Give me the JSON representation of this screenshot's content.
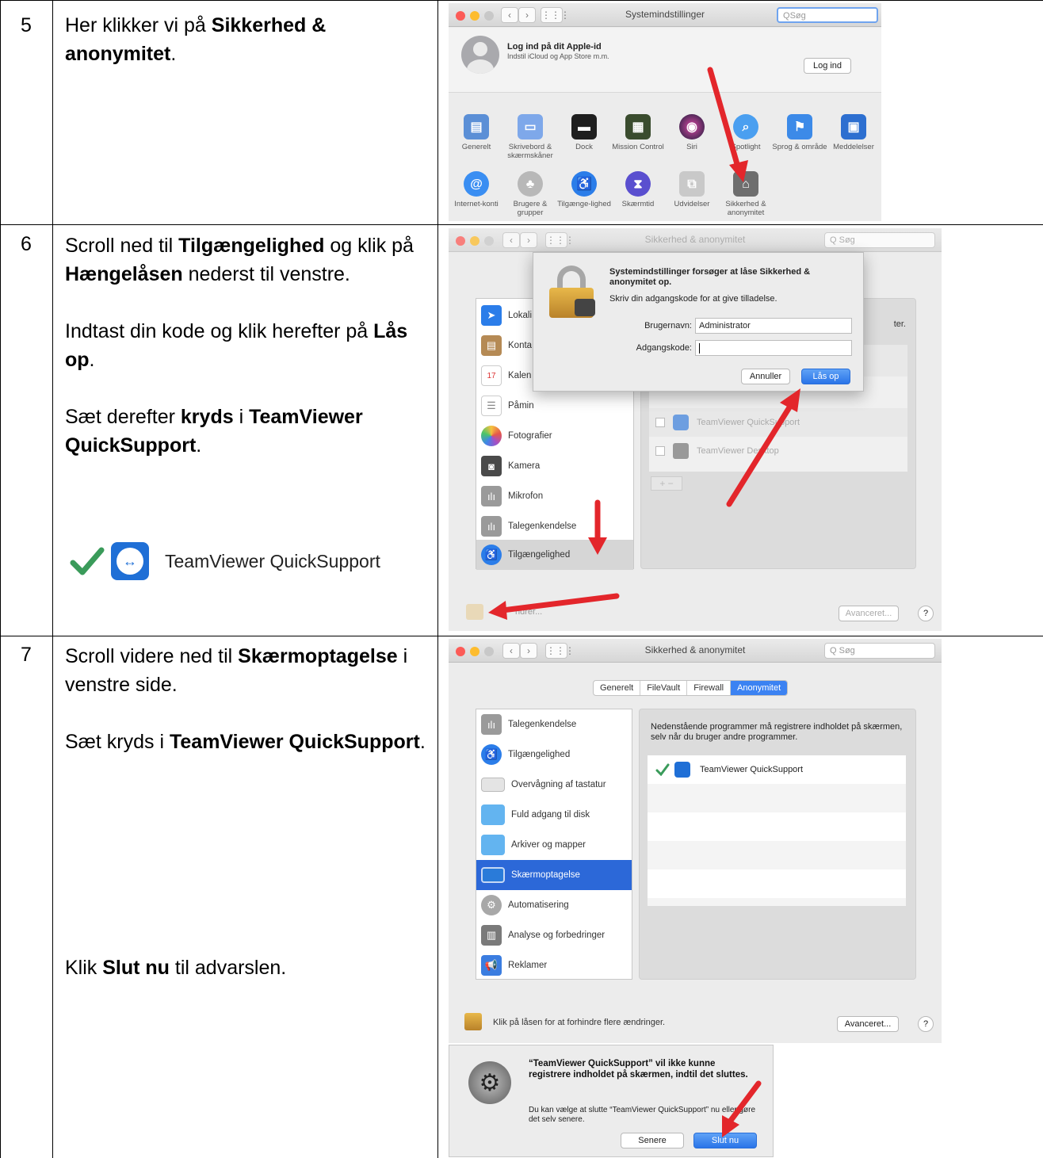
{
  "rows": [
    {
      "num": "5"
    },
    {
      "num": "6"
    },
    {
      "num": "7"
    }
  ],
  "row5": {
    "text_pre": "Her klikker vi på ",
    "text_bold": "Sikkerhed & anonymitet",
    "text_post": ".",
    "window_title": "Systemindstillinger",
    "search_placeholder": "Søg",
    "apple_id_title": "Log ind på dit Apple-id",
    "apple_id_sub": "Indstil iCloud og App Store m.m.",
    "login_button": "Log ind",
    "prefs_row1": [
      "Generelt",
      "Skrivebord & skærmskåner",
      "Dock",
      "Mission Control",
      "Siri",
      "Spotlight",
      "Sprog & område",
      "Meddelelser"
    ],
    "prefs_row2": [
      "Internet-konti",
      "Brugere & grupper",
      "Tilgænge-lighed",
      "Skærmtid",
      "Udvidelser",
      "Sikkerhed & anonymitet"
    ]
  },
  "row6": {
    "p1_a": "Scroll ned til ",
    "p1_b": "Tilgængelighed",
    "p1_c": " og klik på ",
    "p1_d": "Hængelåsen",
    "p1_e": " nederst til venstre.",
    "p2_a": "Indtast din kode og klik herefter på ",
    "p2_b": "Lås op",
    "p2_c": ".",
    "p3_a": "Sæt derefter ",
    "p3_b": "kryds",
    "p3_c": " i ",
    "p3_d": "TeamViewer QuickSupport",
    "p3_e": ".",
    "example_label": "TeamViewer QuickSupport",
    "window_title": "Sikkerhed & anonymitet",
    "search_placeholder": "Søg",
    "dialog_title": "Systemindstillinger forsøger at låse Sikkerhed & anonymitet op.",
    "dialog_sub": "Skriv din adgangskode for at give tilladelse.",
    "username_label": "Brugernavn:",
    "username_value": "Administrator",
    "password_label": "Adgangskode:",
    "cancel_button": "Annuller",
    "unlock_button": "Lås op",
    "sidebar_items": [
      "Lokali",
      "Konta",
      "Kalen",
      "Påmin",
      "Fotografier",
      "Kamera",
      "Mikrofon",
      "Talegenkendelse",
      "Tilgængelighed"
    ],
    "list_items": [
      "TeamViewer QuickSupport",
      "TeamViewer Desktop"
    ],
    "panel_fragment": "ter.",
    "lock_text": "ndrer...",
    "advanced_button": "Avanceret...",
    "help": "?"
  },
  "row7": {
    "p1_a": "Scroll videre ned til ",
    "p1_b": "Skærmoptagelse",
    "p1_c": " i venstre side.",
    "p2_a": "Sæt kryds i ",
    "p2_b": "TeamViewer QuickSupport",
    "p2_c": ".",
    "p3_a": "Klik ",
    "p3_b": "Slut nu",
    "p3_c": " til advarslen.",
    "window_title": "Sikkerhed & anonymitet",
    "search_placeholder": "Søg",
    "tabs": [
      "Generelt",
      "FileVault",
      "Firewall",
      "Anonymitet"
    ],
    "sidebar_items": [
      "Talegenkendelse",
      "Tilgængelighed",
      "Overvågning af tastatur",
      "Fuld adgang til disk",
      "Arkiver og mapper",
      "Skærmoptagelse",
      "Automatisering",
      "Analyse og forbedringer",
      "Reklamer"
    ],
    "panel_desc": "Nedenstående programmer må registrere indholdet på skærmen, selv når du bruger andre programmer.",
    "list_item": "TeamViewer QuickSupport",
    "lock_text": "Klik på låsen for at forhindre flere ændringer.",
    "advanced_button": "Avanceret...",
    "help": "?",
    "alert_title": "“TeamViewer QuickSupport” vil ikke kunne registrere indholdet på skærmen, indtil det sluttes.",
    "alert_body": "Du kan vælge at slutte “TeamViewer QuickSupport” nu eller gøre det selv senere.",
    "later_button": "Senere",
    "quit_button": "Slut nu"
  },
  "colors": {
    "accent": "#2c68d8",
    "arrow": "#e3262b",
    "checkmark": "#3a9b5a",
    "teamviewer": "#1f6fd6"
  }
}
